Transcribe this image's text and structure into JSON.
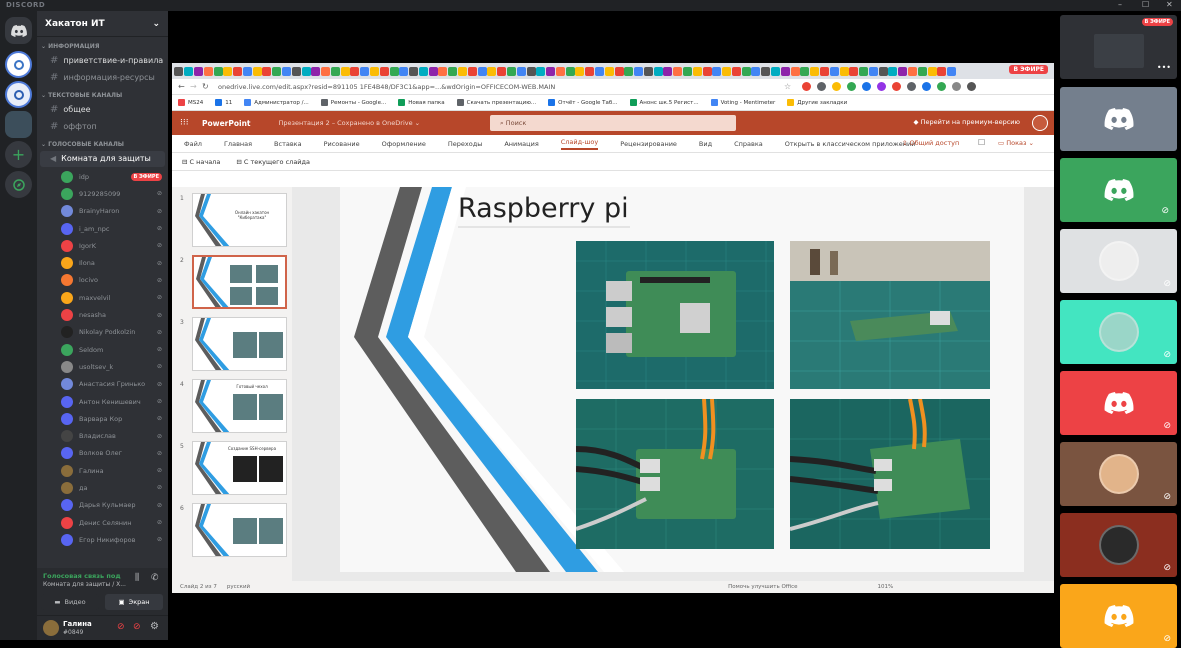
{
  "window": {
    "brand": "DISCORD",
    "controls": [
      "–",
      "☐",
      "✕"
    ]
  },
  "server": {
    "name": "Хакатон ИТ"
  },
  "categories": {
    "info": "ИНФОРМАЦИЯ",
    "text": "ТЕКСТОВЫЕ КАНАЛЫ",
    "voice": "ГОЛОСОВЫЕ КАНАЛЫ"
  },
  "channels": {
    "info": [
      "приветствие-и-правила",
      "информация-ресурсы"
    ],
    "text": [
      "общее",
      "оффтоп"
    ],
    "voice_room": "Комната для защиты"
  },
  "voice_users": [
    {
      "name": "idp",
      "color": "#3ba55d",
      "live": "В ЭФИРЕ"
    },
    {
      "name": "9129285099",
      "color": "#3ba55d"
    },
    {
      "name": "BrainyHaron",
      "color": "#7289da"
    },
    {
      "name": "i_am_npc",
      "color": "#5865f2"
    },
    {
      "name": "IgorK",
      "color": "#ed4245"
    },
    {
      "name": "Ilona",
      "color": "#faa61a"
    },
    {
      "name": "locivo",
      "color": "#f57731"
    },
    {
      "name": "maxvelvil",
      "color": "#faa61a"
    },
    {
      "name": "nesasha",
      "color": "#ed4245"
    },
    {
      "name": "Nikolay Podkolzin",
      "color": "#222"
    },
    {
      "name": "Seldom",
      "color": "#3ba55d"
    },
    {
      "name": "usoltsev_k",
      "color": "#888"
    },
    {
      "name": "Анастасия Гринько",
      "color": "#7289da"
    },
    {
      "name": "Антон Кенишевич",
      "color": "#5865f2"
    },
    {
      "name": "Варвара Кор",
      "color": "#5865f2"
    },
    {
      "name": "Владислав",
      "color": "#444"
    },
    {
      "name": "Волков Олег",
      "color": "#5865f2"
    },
    {
      "name": "Галина",
      "color": "#8a6d3b"
    },
    {
      "name": "да",
      "color": "#8a6d3b"
    },
    {
      "name": "Дарья Кульмаер",
      "color": "#5865f2"
    },
    {
      "name": "Денис Селянин",
      "color": "#ed4245"
    },
    {
      "name": "Егор Никифоров",
      "color": "#5865f2"
    }
  ],
  "voice_panel": {
    "status": "Голосовая связь под",
    "sub": "Комната для защиты / Х...",
    "video": "Видео",
    "screen": "Экран"
  },
  "user": {
    "name": "Галина",
    "tag": "#0849"
  },
  "browser": {
    "live": "В ЭФИРЕ",
    "url": "onedrive.live.com/edit.aspx?resid=891105 1FE4B48/DF3C1&app=...&wdOrigin=OFFICECOM-WEB.MAIN",
    "bookmarks": [
      "MS24",
      "11",
      "Администратор /...",
      "Ремонты - Google...",
      "Новая папка",
      "Скачать презентацию...",
      "Отчёт - Google Таб...",
      "Анонс шк.5 Регист...",
      "Voting - Mentimeter",
      "Другие закладки"
    ]
  },
  "powerpoint": {
    "brand": "PowerPoint",
    "doc": "Презентация 2 – Сохранено в OneDrive ⌄",
    "search": "Поиск",
    "premium": "Перейти на премиум-версию",
    "ribbon": [
      "Файл",
      "Главная",
      "Вставка",
      "Рисование",
      "Оформление",
      "Переходы",
      "Анимация",
      "Слайд-шоу",
      "Рецензирование",
      "Вид",
      "Справка",
      "Открыть в классическом приложении"
    ],
    "share": "Общий доступ",
    "show": "Показ",
    "sub": [
      "С начала",
      "С текущего слайда"
    ],
    "thumbs": [
      {
        "n": "1",
        "title": "Онлайн хакатон \"Кибератака\""
      },
      {
        "n": "2",
        "title": ""
      },
      {
        "n": "3",
        "title": ""
      },
      {
        "n": "4",
        "title": "Готовый чехол"
      },
      {
        "n": "5",
        "title": "Создание SSH-сервера"
      },
      {
        "n": "6",
        "title": ""
      }
    ],
    "slide_title": "Raspberry pi",
    "status_left": "Слайд 2 из 7",
    "status_lang": "русский",
    "status_right": "Помочь улучшить Office",
    "zoom": "101%"
  },
  "tiles": [
    {
      "color": "#2f3136",
      "muted": false
    },
    {
      "color": "#747f8d",
      "muted": false
    },
    {
      "color": "#3ba55d",
      "muted": true
    },
    {
      "color": "#dfe1e3",
      "muted": true
    },
    {
      "color": "#43e5c1",
      "muted": true
    },
    {
      "color": "#ed4245",
      "muted": true
    },
    {
      "color": "#7a5440",
      "muted": true
    },
    {
      "color": "#8b2e1f",
      "muted": true
    },
    {
      "color": "#faa61a",
      "muted": true
    }
  ],
  "tile_live": "В ЭФИРЕ"
}
